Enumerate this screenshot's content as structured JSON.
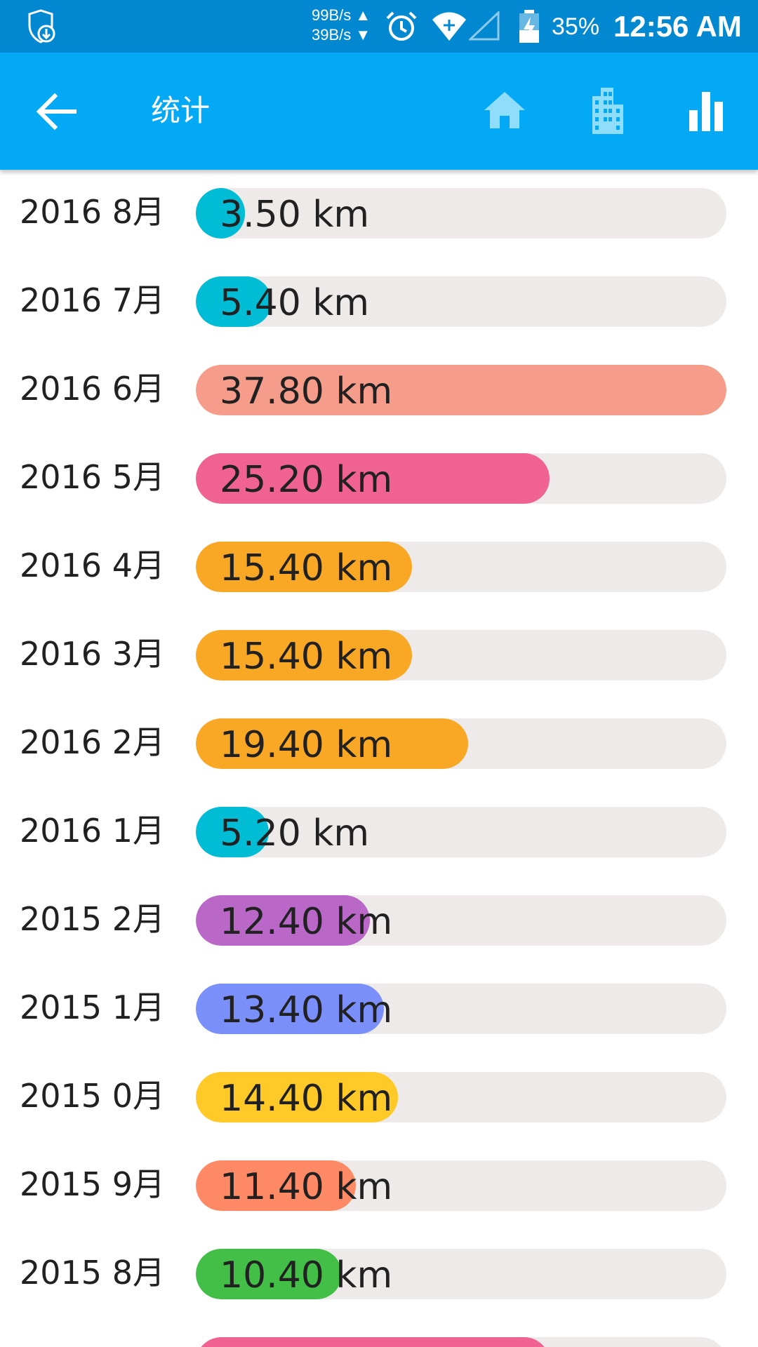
{
  "status_bar": {
    "net_up": "99B/s",
    "net_down": "39B/s",
    "battery": "35%",
    "time": "12:56 AM",
    "icons": [
      "shield-download-icon",
      "alarm-icon",
      "wifi-icon",
      "signal-icon",
      "battery-charging-icon"
    ]
  },
  "app_bar": {
    "title": "统计",
    "icons": [
      "back-arrow-icon",
      "home-icon",
      "city-icon",
      "bar-chart-icon"
    ],
    "color": "#03a9f4"
  },
  "max_km": 37.8,
  "rows": [
    {
      "month": "2016 8月",
      "distance": "3.50 km",
      "value": 3.5,
      "color": "#00bcd4"
    },
    {
      "month": "2016 7月",
      "distance": "5.40 km",
      "value": 5.4,
      "color": "#00bcd4"
    },
    {
      "month": "2016 6月",
      "distance": "37.80 km",
      "value": 37.8,
      "color": "#f59c8a"
    },
    {
      "month": "2016 5月",
      "distance": "25.20 km",
      "value": 25.2,
      "color": "#f06292"
    },
    {
      "month": "2016 4月",
      "distance": "15.40 km",
      "value": 15.4,
      "color": "#f9a825"
    },
    {
      "month": "2016 3月",
      "distance": "15.40 km",
      "value": 15.4,
      "color": "#f9a825"
    },
    {
      "month": "2016 2月",
      "distance": "19.40 km",
      "value": 19.4,
      "color": "#f9a825"
    },
    {
      "month": "2016 1月",
      "distance": "5.20 km",
      "value": 5.2,
      "color": "#00bcd4"
    },
    {
      "month": "2015 2月",
      "distance": "12.40 km",
      "value": 12.4,
      "color": "#ba68c8"
    },
    {
      "month": "2015 1月",
      "distance": "13.40 km",
      "value": 13.4,
      "color": "#7b8ffa"
    },
    {
      "month": "2015 0月",
      "distance": "14.40 km",
      "value": 14.4,
      "color": "#ffca28"
    },
    {
      "month": "2015 9月",
      "distance": "11.40 km",
      "value": 11.4,
      "color": "#ff8a65"
    },
    {
      "month": "2015 8月",
      "distance": "10.40 km",
      "value": 10.4,
      "color": "#43bf47"
    },
    {
      "month": "",
      "distance": "",
      "value": 25.2,
      "color": "#f06292"
    }
  ]
}
